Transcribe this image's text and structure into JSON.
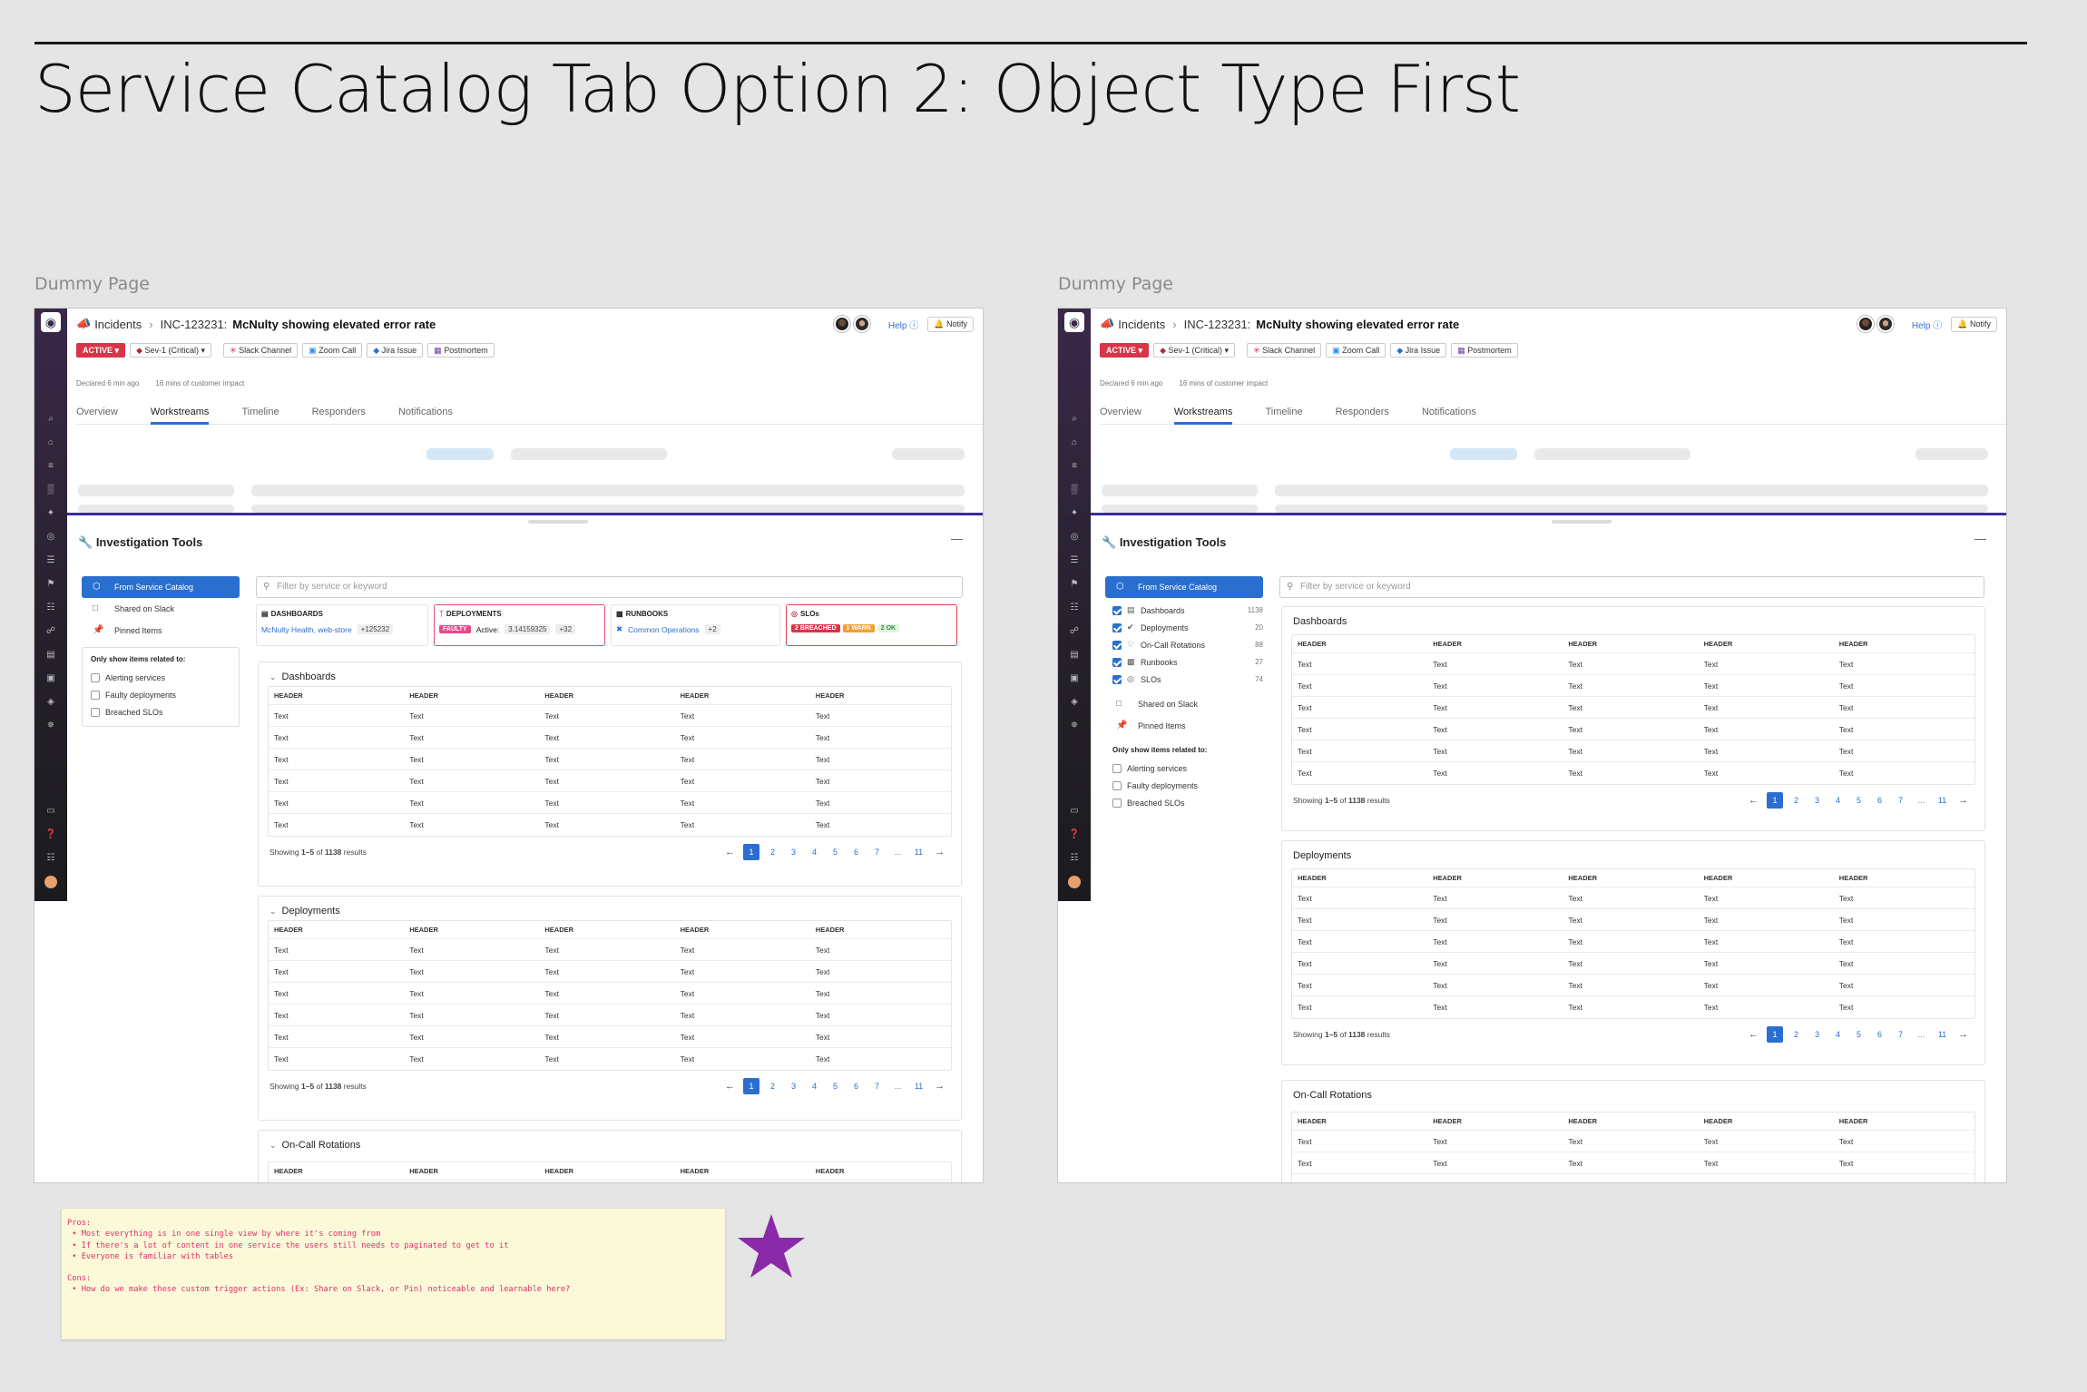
{
  "page_title": "Service Catalog Tab Option 2: Object Type First",
  "frames": {
    "left_label": "Dummy Page",
    "right_label": "Dummy Page"
  },
  "header": {
    "incidents": "Incidents",
    "incident_id": "INC-123231:",
    "incident_title": "McNulty showing elevated error rate",
    "help": "Help",
    "notify": "Notify",
    "status": "ACTIVE",
    "severity": "Sev-1 (Critical)",
    "actions": [
      "Slack Channel",
      "Zoom Call",
      "Jira Issue",
      "Postmortem"
    ],
    "declared": "Declared 6 min ago",
    "impact": "16 mins of customer impact"
  },
  "tabs": [
    "Overview",
    "Workstreams",
    "Timeline",
    "Responders",
    "Notifications"
  ],
  "selected_tab": "Workstreams",
  "tools": {
    "title": "Investigation Tools",
    "minimize": "—",
    "search_placeholder": "Filter by service or keyword",
    "sources": {
      "service_catalog": "From Service Catalog",
      "slack": "Shared on Slack",
      "pinned": "Pinned Items"
    },
    "filter_title": "Only show items related to:",
    "filters": [
      "Alerting services",
      "Faulty deployments",
      "Breached SLOs"
    ],
    "object_types": [
      {
        "label": "Dashboards",
        "count": "1138"
      },
      {
        "label": "Deployments",
        "count": "20"
      },
      {
        "label": "On-Call Rotations",
        "count": "88"
      },
      {
        "label": "Runbooks",
        "count": "27"
      },
      {
        "label": "SLOs",
        "count": "74"
      }
    ]
  },
  "summary": {
    "dashboards": {
      "label": "DASHBOARDS",
      "value": "McNulty Health, web-store",
      "more": "+125232"
    },
    "deployments": {
      "label": "DEPLOYMENTS",
      "badge": "FAULTY",
      "active_label": "Active:",
      "version": "3.14159325",
      "more": "+32"
    },
    "runbooks": {
      "label": "RUNBOOKS",
      "value": "Common Operations",
      "more": "+2"
    },
    "slos": {
      "label": "SLOs",
      "breached": "2 BREACHED",
      "warn": "1 WARN",
      "ok": "2 OK"
    }
  },
  "sections": {
    "dashboards": "Dashboards",
    "deployments": "Deployments",
    "oncall": "On-Call Rotations"
  },
  "table": {
    "header": "HEADER",
    "cell": "Text",
    "showing_prefix": "Showing ",
    "showing_range": "1–5",
    "showing_of": " of ",
    "showing_total": "1138",
    "showing_suffix": " results",
    "pages": [
      "1",
      "2",
      "3",
      "4",
      "5",
      "6",
      "7",
      "...",
      "11"
    ]
  },
  "note": {
    "pros_title": "Pros:",
    "pros": [
      " • Most everything is in one single view by where it's coming from",
      " • If there's a lot of content in one service the users still needs to paginated to get to it",
      " • Everyone is familiar with tables"
    ],
    "cons_title": "Cons:",
    "cons": [
      " • How do we make these custom trigger actions (Ex: Share on Slack, or Pin) noticeable and learnable here?"
    ]
  },
  "colors": {
    "accent": "#2a6fcf",
    "active_status": "#d8344a",
    "divider_purple": "#3b2a9c",
    "star": "#8a2aa8",
    "note_text": "#e02f6e"
  }
}
